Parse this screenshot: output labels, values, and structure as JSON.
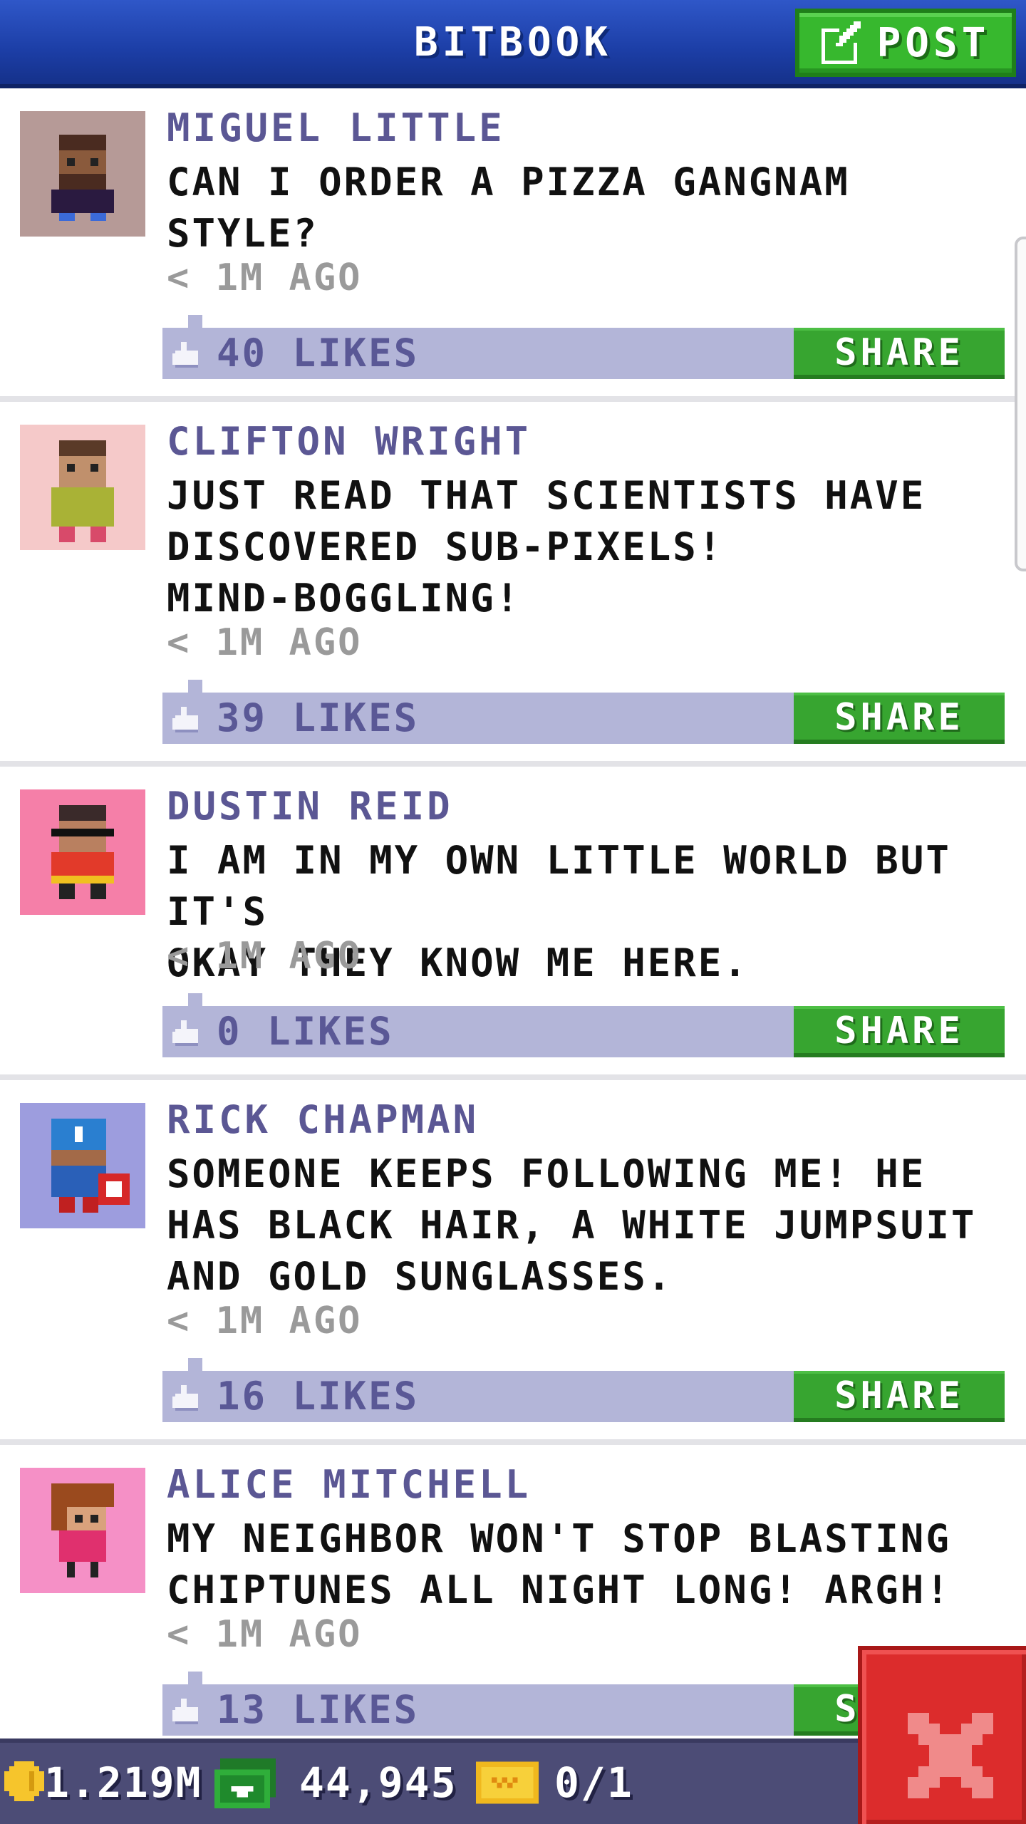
{
  "header": {
    "title": "BITBOOK",
    "post_label": "POST"
  },
  "posts": [
    {
      "name": "MIGUEL LITTLE",
      "lines": [
        "CAN I ORDER A PIZZA GANGNAM",
        "STYLE?"
      ],
      "time": "< 1M AGO",
      "likes": "40 LIKES",
      "share_label": "SHARE",
      "avatar_bg": "#b69a97"
    },
    {
      "name": "CLIFTON WRIGHT",
      "lines": [
        "JUST READ THAT SCIENTISTS HAVE",
        "DISCOVERED SUB-PIXELS!",
        "MIND-BOGGLING!"
      ],
      "time": "< 1M AGO",
      "likes": "39 LIKES",
      "share_label": "SHARE",
      "avatar_bg": "#f5c9c9"
    },
    {
      "name": "DUSTIN REID",
      "lines": [
        "I AM IN MY OWN LITTLE WORLD BUT IT'S",
        "OKAY THEY KNOW ME HERE."
      ],
      "time": "< 1M AGO",
      "likes": "0 LIKES",
      "share_label": "SHARE",
      "avatar_bg": "#f57fa8"
    },
    {
      "name": "RICK CHAPMAN",
      "lines": [
        "SOMEONE KEEPS FOLLOWING ME! HE",
        "HAS BLACK HAIR, A WHITE JUMPSUIT",
        "AND GOLD SUNGLASSES."
      ],
      "time": "< 1M AGO",
      "likes": "16 LIKES",
      "share_label": "SHARE",
      "avatar_bg": "#9d9dde"
    },
    {
      "name": "ALICE MITCHELL",
      "lines": [
        "MY NEIGHBOR WON'T STOP BLASTING",
        "CHIPTUNES ALL NIGHT LONG! ARGH!"
      ],
      "time": "< 1M AGO",
      "likes": "13 LIKES",
      "share_label": "SHARE",
      "avatar_bg": "#f590c6"
    }
  ],
  "bottom_bar": {
    "coins": "1.219M",
    "bux": "44,945",
    "tickets": "0/1"
  },
  "icons": {
    "post": "edit-icon",
    "like": "thumbs-up-icon",
    "coins": "coin-icon",
    "bux": "bux-icon",
    "tickets": "ticket-icon",
    "close": "close-icon"
  },
  "colors": {
    "header": "#1c3ea6",
    "post_button": "#37b82e",
    "like_bar": "#b3b5d8",
    "share_button": "#37a530",
    "name_text": "#5b5794",
    "bottom_bar": "#4c4c76",
    "close_button": "#dc2c2c"
  }
}
